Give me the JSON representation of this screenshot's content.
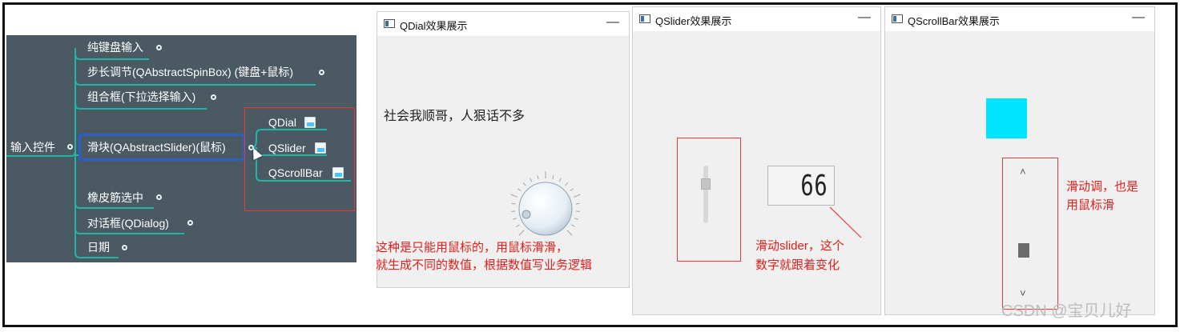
{
  "mindmap": {
    "root": "输入控件",
    "items": [
      "纯键盘输入",
      "步长调节(QAbstractSpinBox) (键盘+鼠标)",
      "组合框(下拉选择输入)",
      "滑块(QAbstractSlider)(鼠标)",
      "橡皮筋选中",
      "对话框(QDialog)",
      "日期"
    ],
    "sub_items": [
      "QDial",
      "QSlider",
      "QScrollBar"
    ]
  },
  "windows": {
    "dial": {
      "title": "QDial效果展示",
      "min_symbol": "—",
      "label": "社会我顺哥，人狠话不多",
      "note_line1": "这种是只能用鼠标的，用鼠标滑滑，",
      "note_line2": "就生成不同的数值，根据数值写业务逻辑"
    },
    "slider": {
      "title": "QSlider效果展示",
      "min_symbol": "—",
      "lcd_value": "66",
      "note_line1": "滑动slider，这个",
      "note_line2": "数字就跟着变化",
      "slider_value": 0.66
    },
    "scrollbar": {
      "title": "QScrollBar效果展示",
      "min_symbol": "—",
      "up_arrow": "˄",
      "down_arrow": "˅",
      "note_line1": "滑动调，也是",
      "note_line2": "用鼠标滑",
      "square_color": "#00e5ff",
      "scroll_value": 0.66
    }
  },
  "watermark": "CSDN @宝贝儿好"
}
